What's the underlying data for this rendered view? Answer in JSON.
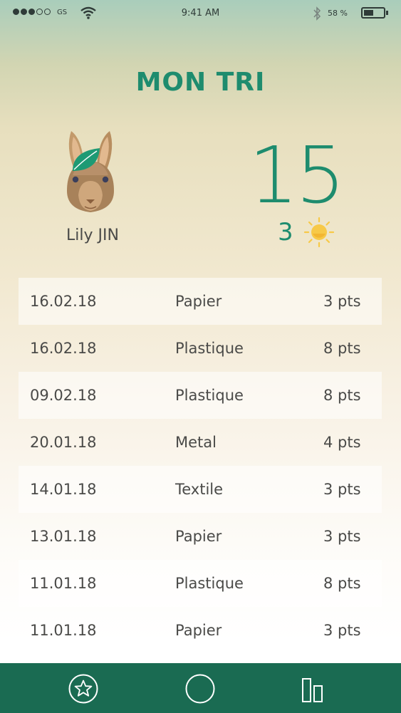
{
  "status_bar": {
    "carrier": "GS",
    "time": "9:41 AM",
    "battery_percent": "58 %",
    "battery_level": 0.5,
    "signal_bars_filled": 3,
    "signal_bars_total": 5
  },
  "header": {
    "title": "MON TRI"
  },
  "profile": {
    "name": "Lily JIN",
    "avatar_icon": "rabbit-with-leaf-icon"
  },
  "score": {
    "points": "15",
    "suns": "3",
    "sun_icon": "sun-icon"
  },
  "colors": {
    "accent": "#1e8c6e",
    "nav_background": "#1a6b52",
    "text": "#4a4a48",
    "sun": "#f7c948"
  },
  "history": [
    {
      "date": "16.02.18",
      "type": "Papier",
      "points": "3 pts"
    },
    {
      "date": "16.02.18",
      "type": "Plastique",
      "points": "8 pts"
    },
    {
      "date": "09.02.18",
      "type": "Plastique",
      "points": "8 pts"
    },
    {
      "date": "20.01.18",
      "type": "Metal",
      "points": "4 pts"
    },
    {
      "date": "14.01.18",
      "type": "Textile",
      "points": "3 pts"
    },
    {
      "date": "13.01.18",
      "type": "Papier",
      "points": "3 pts"
    },
    {
      "date": "11.01.18",
      "type": "Plastique",
      "points": "8 pts"
    },
    {
      "date": "11.01.18",
      "type": "Papier",
      "points": "3 pts"
    }
  ],
  "nav": [
    {
      "name": "favorites",
      "icon": "star-circle-icon"
    },
    {
      "name": "home",
      "icon": "circle-icon"
    },
    {
      "name": "stats",
      "icon": "bar-chart-icon"
    }
  ]
}
